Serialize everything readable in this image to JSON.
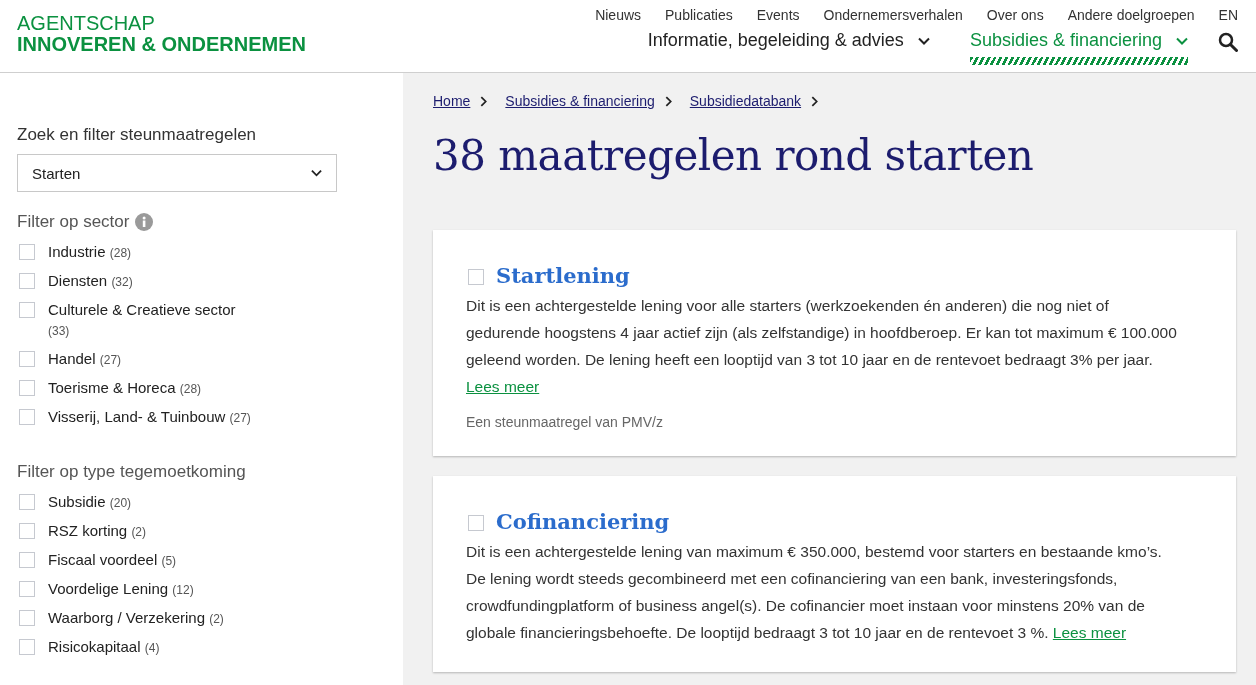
{
  "logo": {
    "line_1": "AGENTSCHAP",
    "line_2": "INNOVEREN & ONDERNEMEN"
  },
  "top_nav": [
    "Nieuws",
    "Publicaties",
    "Events",
    "Ondernemersverhalen",
    "Over ons",
    "Andere doelgroepen",
    "EN"
  ],
  "main_nav": [
    {
      "label": "Informatie, begeleiding & advies",
      "selected": false
    },
    {
      "label": "Subsidies & financiering",
      "selected": true
    }
  ],
  "sidebar": {
    "search_label": "Zoek en filter steunmaatregelen",
    "select": {
      "value": "Starten"
    },
    "filters": [
      {
        "title": "Filter op sector",
        "info": true,
        "options": [
          {
            "label": "Industrie",
            "count": "(28)",
            "checked": false
          },
          {
            "label": "Diensten",
            "count": "(32)",
            "checked": false
          },
          {
            "label": "Culturele & Creatieve sector",
            "count": "(33)",
            "checked": false
          },
          {
            "label": "Handel",
            "count": "(27)",
            "checked": false
          },
          {
            "label": "Toerisme & Horeca",
            "count": "(28)",
            "checked": false
          },
          {
            "label": "Visserij, Land- & Tuinbouw",
            "count": "(27)",
            "checked": false
          }
        ]
      },
      {
        "title": "Filter op type tegemoetkoming",
        "info": false,
        "options": [
          {
            "label": "Subsidie",
            "count": "(20)",
            "checked": false
          },
          {
            "label": "RSZ korting",
            "count": "(2)",
            "checked": false
          },
          {
            "label": "Fiscaal voordeel",
            "count": "(5)",
            "checked": false
          },
          {
            "label": "Voordelige Lening",
            "count": "(12)",
            "checked": false
          },
          {
            "label": "Waarborg / Verzekering",
            "count": "(2)",
            "checked": false
          },
          {
            "label": "Risicokapitaal",
            "count": "(4)",
            "checked": false
          }
        ]
      }
    ]
  },
  "breadcrumbs": [
    "Home",
    "Subsidies & financiering",
    "Subsidiedatabank"
  ],
  "heading": "38 maatregelen rond starten",
  "results": [
    {
      "title": "Startlening",
      "checked": false,
      "description": "Dit is een achtergestelde lening voor alle starters (werkzoekenden én anderen) die nog niet of gedurende hoogstens 4 jaar actief zijn (als zelfstandige) in hoofdberoep. Er kan tot maximum € 100.000 geleend worden. De lening heeft een looptijd van 3 tot 10 jaar en de rentevoet bedraagt 3% per jaar.",
      "link": "Lees meer",
      "provider": "Een steunmaatregel van PMV/z"
    },
    {
      "title": "Cofinanciering",
      "checked": false,
      "description": "Dit is een achtergestelde lening van maximum € 350.000, bestemd voor starters en bestaande kmo’s. De lening wordt steeds gecombineerd met een cofinanciering van een bank, investeringsfonds, crowdfundingplatform of business angel(s). De cofinancier moet instaan voor minstens 20% van de globale financieringsbehoefte. De looptijd bedraagt 3 tot 10 jaar en de rentevoet 3 %.",
      "link": "Lees meer"
    }
  ]
}
